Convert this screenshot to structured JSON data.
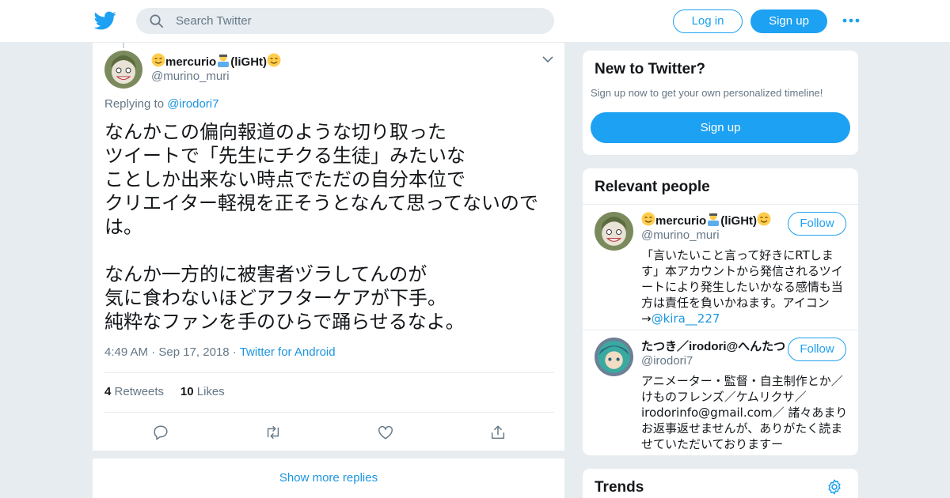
{
  "nav": {
    "logo_icon": "twitter-bird-icon",
    "search_placeholder": "Search Twitter",
    "login_label": "Log in",
    "signup_label": "Sign up",
    "more_icon": "more-dots-icon"
  },
  "tweet": {
    "author_name": "mercurio",
    "author_name_suffix": "(liGHt)",
    "author_handle": "@murino_muri",
    "replying_prefix": "Replying to",
    "replying_to": "@irodori7",
    "text": "なんかこの偏向報道のような切り取った\nツイートで「先生にチクる生徒」みたいな\nことしか出来ない時点でただの自分本位で\nクリエイター軽視を正そうとなんて思ってないので\nは。\n\nなんか一方的に被害者ヅラしてんのが\n気に食わないほどアフターケアが下手。\n純粋なファンを手のひらで踊らせるなよ。",
    "time": "4:49 AM",
    "date": "Sep 17, 2018",
    "source": "Twitter for Android",
    "retweets_count": "4",
    "retweets_label": "Retweets",
    "likes_count": "10",
    "likes_label": "Likes",
    "actions": [
      "reply-icon",
      "retweet-icon",
      "like-icon",
      "share-icon"
    ],
    "show_more_label": "Show more replies"
  },
  "sidebar": {
    "new_to_twitter": {
      "title": "New to Twitter?",
      "subtitle": "Sign up now to get your own personalized timeline!",
      "button_label": "Sign up"
    },
    "relevant_people": {
      "title": "Relevant people",
      "people": [
        {
          "name": "mercurio",
          "name_suffix": "(liGHt)",
          "handle": "@murino_muri",
          "follow_label": "Follow",
          "bio": "「言いたいこと言って好きにRTします」本アカウントから発信されるツイートにより発生したいかなる感情も当方は責任を負いかねます。アイコン→",
          "bio_link": "@kira__227"
        },
        {
          "name": "たつき／irodori@へんたつ",
          "handle": "@irodori7",
          "follow_label": "Follow",
          "bio": "アニメーター・監督・自主制作とか／けものフレンズ／ケムリクサ／irodorinfo@gmail.com／ 諸々あまりお返事返せませんが、ありがたく読ませていただいておりますー"
        }
      ]
    },
    "trends": {
      "title": "Trends",
      "settings_icon": "gear-icon"
    }
  },
  "colors": {
    "brand": "#1da1f2",
    "link": "#1b95e0",
    "muted": "#657786",
    "background": "#e6ecf0"
  }
}
